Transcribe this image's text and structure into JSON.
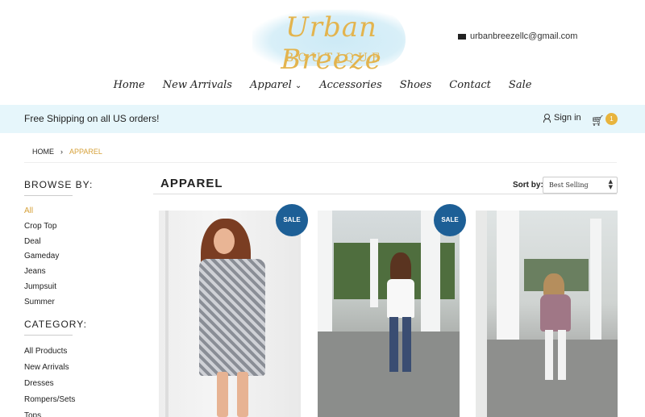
{
  "header": {
    "logo_script": "Urban Breeze",
    "logo_sub": "BOUTIQUE",
    "email": "urbanbreezellc@gmail.com",
    "nav": [
      "Home",
      "New Arrivals",
      "Apparel",
      "Accessories",
      "Shoes",
      "Contact",
      "Sale"
    ]
  },
  "shipbar": {
    "message": "Free Shipping on all US orders!",
    "sign_in": "Sign in",
    "cart_count": "1"
  },
  "breadcrumb": {
    "home": "HOME",
    "current": "APPAREL"
  },
  "sidebar": {
    "browse_title": "BROWSE BY:",
    "browse_items": [
      "All",
      "Crop Top",
      "Deal",
      "Gameday",
      "Jeans",
      "Jumpsuit",
      "Summer"
    ],
    "category_title": "CATEGORY:",
    "category_items": [
      "All Products",
      "New Arrivals",
      "Dresses",
      "Rompers/Sets",
      "Tops"
    ]
  },
  "main": {
    "heading": "APPAREL",
    "sort_label": "Sort by:",
    "sort_value": "Best Selling",
    "sale_badge": "SALE"
  },
  "colors": {
    "accent": "#d6a13a",
    "sale": "#1d5f96",
    "shipbar": "#e6f6fb",
    "badge": "#e8b43d"
  }
}
